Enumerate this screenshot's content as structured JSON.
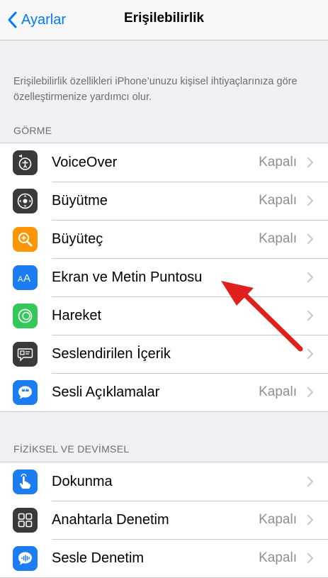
{
  "nav": {
    "back_label": "Ayarlar",
    "title": "Erişilebilirlik"
  },
  "description": "Erişilebilirlik özellikleri iPhone’unuzu kişisel ihtiyaçlarınıza göre özelleştirmenize yardımcı olur.",
  "sections": {
    "gorme": {
      "header": "GÖRME",
      "items": [
        {
          "label": "VoiceOver",
          "value": "Kapalı",
          "icon": "voiceover-icon",
          "color": "#3a3a3c"
        },
        {
          "label": "Büyütme",
          "value": "Kapalı",
          "icon": "zoom-icon",
          "color": "#3a3a3c"
        },
        {
          "label": "Büyüteç",
          "value": "Kapalı",
          "icon": "magnifier-icon",
          "color": "#ff9500"
        },
        {
          "label": "Ekran ve Metin Puntosu",
          "value": "",
          "icon": "text-size-icon",
          "color": "#1c7cf2"
        },
        {
          "label": "Hareket",
          "value": "",
          "icon": "motion-icon",
          "color": "#34c759"
        },
        {
          "label": "Seslendirilen İçerik",
          "value": "",
          "icon": "spoken-content-icon",
          "color": "#3a3a3c"
        },
        {
          "label": "Sesli Açıklamalar",
          "value": "Kapalı",
          "icon": "audio-descriptions-icon",
          "color": "#1c7cf2"
        }
      ]
    },
    "fiziksel": {
      "header": "FİZİKSEL VE DEVİMSEL",
      "items": [
        {
          "label": "Dokunma",
          "value": "",
          "icon": "touch-icon",
          "color": "#1c7cf2"
        },
        {
          "label": "Anahtarla Denetim",
          "value": "Kapalı",
          "icon": "switch-control-icon",
          "color": "#3a3a3c"
        },
        {
          "label": "Sesle Denetim",
          "value": "Kapalı",
          "icon": "voice-control-icon",
          "color": "#1c7cf2"
        }
      ]
    }
  },
  "colors": {
    "accent": "#007aff",
    "annotation_arrow": "#e0201d"
  }
}
